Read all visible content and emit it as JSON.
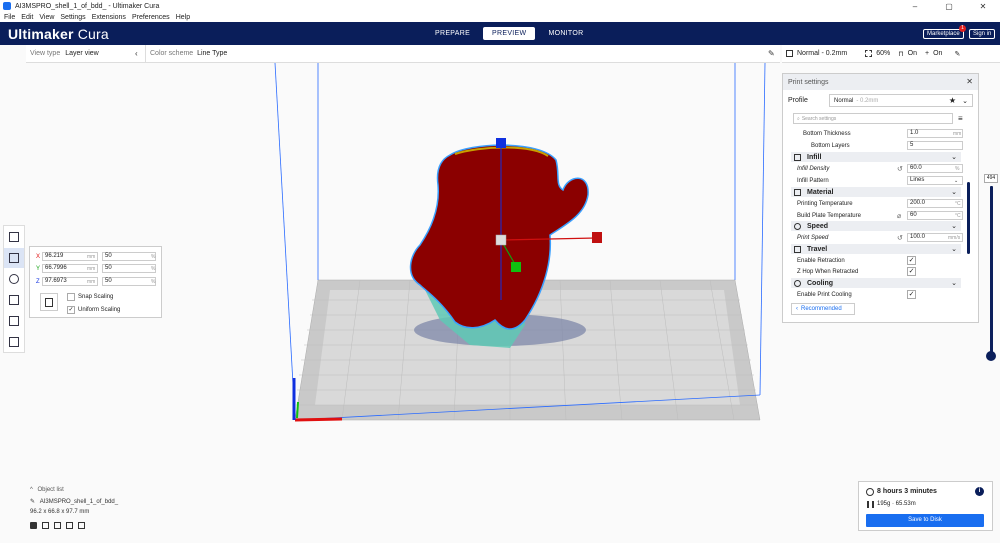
{
  "window": {
    "title": "AI3MSPRO_shell_1_of_bdd_ - Ultimaker Cura",
    "controls": [
      "–",
      "▢",
      "✕"
    ]
  },
  "menu": [
    "File",
    "Edit",
    "View",
    "Settings",
    "Extensions",
    "Preferences",
    "Help"
  ],
  "header": {
    "logo_bold": "Ultimaker",
    "logo_light": "Cura",
    "stages": [
      "PREPARE",
      "PREVIEW",
      "MONITOR"
    ],
    "active_stage": "PREVIEW",
    "marketplace": "Marketplace",
    "marketplace_badge": "1",
    "sign_in": "Sign in"
  },
  "viewbar": {
    "view_type_label": "View type",
    "view_type_value": "Layer view",
    "color_scheme_label": "Color scheme",
    "color_scheme_value": "Line Type"
  },
  "setup": {
    "profile": "Normal - 0.2mm",
    "infill": "60%",
    "support": "On",
    "adhesion": "On"
  },
  "print_settings": {
    "title": "Print settings",
    "profile_label": "Profile",
    "profile_value": "Normal",
    "profile_hint": "- 0.2mm",
    "search_placeholder": "Search settings",
    "rows": {
      "bottom_thickness": {
        "name": "Bottom Thickness",
        "value": "1.0",
        "unit": "mm"
      },
      "bottom_layers": {
        "name": "Bottom Layers",
        "value": "5"
      },
      "infill_cat": "Infill",
      "infill_density": {
        "name": "Infill Density",
        "value": "60.0",
        "unit": "%"
      },
      "infill_pattern": {
        "name": "Infill Pattern",
        "value": "Lines"
      },
      "material_cat": "Material",
      "printing_temp": {
        "name": "Printing Temperature",
        "value": "200.0",
        "unit": "°C"
      },
      "plate_temp": {
        "name": "Build Plate Temperature",
        "value": "60",
        "unit": "°C"
      },
      "speed_cat": "Speed",
      "print_speed": {
        "name": "Print Speed",
        "value": "100.0",
        "unit": "mm/s"
      },
      "travel_cat": "Travel",
      "enable_retraction": {
        "name": "Enable Retraction",
        "checked": true
      },
      "zhop": {
        "name": "Z Hop When Retracted",
        "checked": true
      },
      "cooling_cat": "Cooling",
      "enable_cooling": {
        "name": "Enable Print Cooling",
        "checked": true
      }
    },
    "recommended": "Recommended"
  },
  "scale": {
    "x_mm": "96.219",
    "x_pct": "50",
    "y_mm": "66.7996",
    "y_pct": "50",
    "z_mm": "97.6973",
    "z_pct": "50",
    "unit_mm": "mm",
    "unit_pct": "%",
    "snap_scaling": "Snap Scaling",
    "uniform_scaling": "Uniform Scaling",
    "snap_checked": false,
    "uniform_checked": true
  },
  "objects": {
    "header": "Object list",
    "name": "AI3MSPRO_shell_1_of_bdd_",
    "dims": "96.2 x 66.8 x 97.7 mm"
  },
  "estimate": {
    "time": "8 hours 3 minutes",
    "material": "195g · 65.53m",
    "save": "Save to Disk"
  },
  "layer": {
    "current": "494"
  },
  "colors": {
    "header_bg": "#0a1e5a",
    "accent": "#196ef0",
    "model": "#8b0000",
    "infill": "#5fc9b5",
    "plate": "#c8c8c8",
    "volume_edge": "#2a6bff"
  }
}
